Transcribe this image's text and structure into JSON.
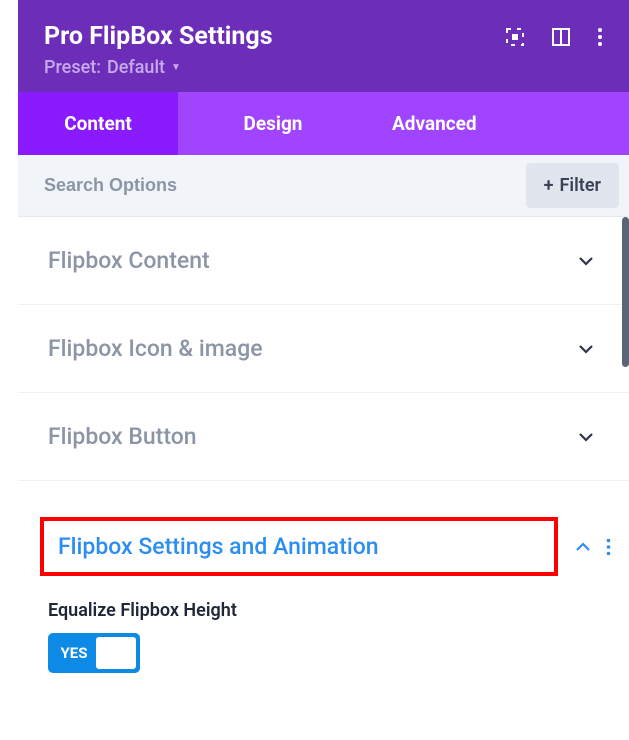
{
  "header": {
    "title": "Pro FlipBox Settings",
    "preset_label": "Preset:",
    "preset_value": "Default"
  },
  "tabs": {
    "content": "Content",
    "design": "Design",
    "advanced": "Advanced"
  },
  "search": {
    "placeholder": "Search Options",
    "filter_label": "Filter"
  },
  "sections": [
    {
      "title": "Flipbox Content"
    },
    {
      "title": "Flipbox Icon & image"
    },
    {
      "title": "Flipbox Button"
    }
  ],
  "expanded_section": {
    "title": "Flipbox Settings and Animation"
  },
  "field": {
    "label": "Equalize Flipbox Height",
    "toggle_value": "YES"
  }
}
